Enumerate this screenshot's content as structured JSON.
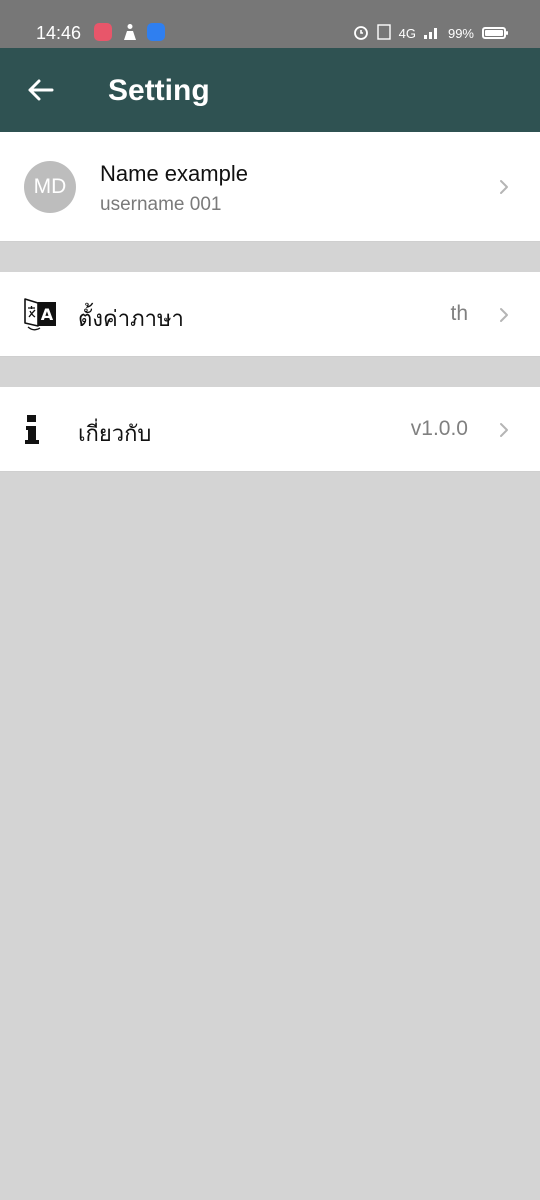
{
  "status_bar": {
    "time": "14:46",
    "signal_text": "4G",
    "battery_text": "99%"
  },
  "app_bar": {
    "title": "Setting"
  },
  "profile": {
    "initials": "MD",
    "name": "Name example",
    "username": "username 001"
  },
  "settings": [
    {
      "label": "ตั้งค่าภาษา",
      "value": "th",
      "icon": "translate-icon"
    },
    {
      "label": "เกี่ยวกับ",
      "value": "v1.0.0",
      "icon": "info-icon"
    }
  ],
  "colors": {
    "app_bar": "#2f5252",
    "status_bar": "#777777",
    "background": "#d4d4d4"
  }
}
